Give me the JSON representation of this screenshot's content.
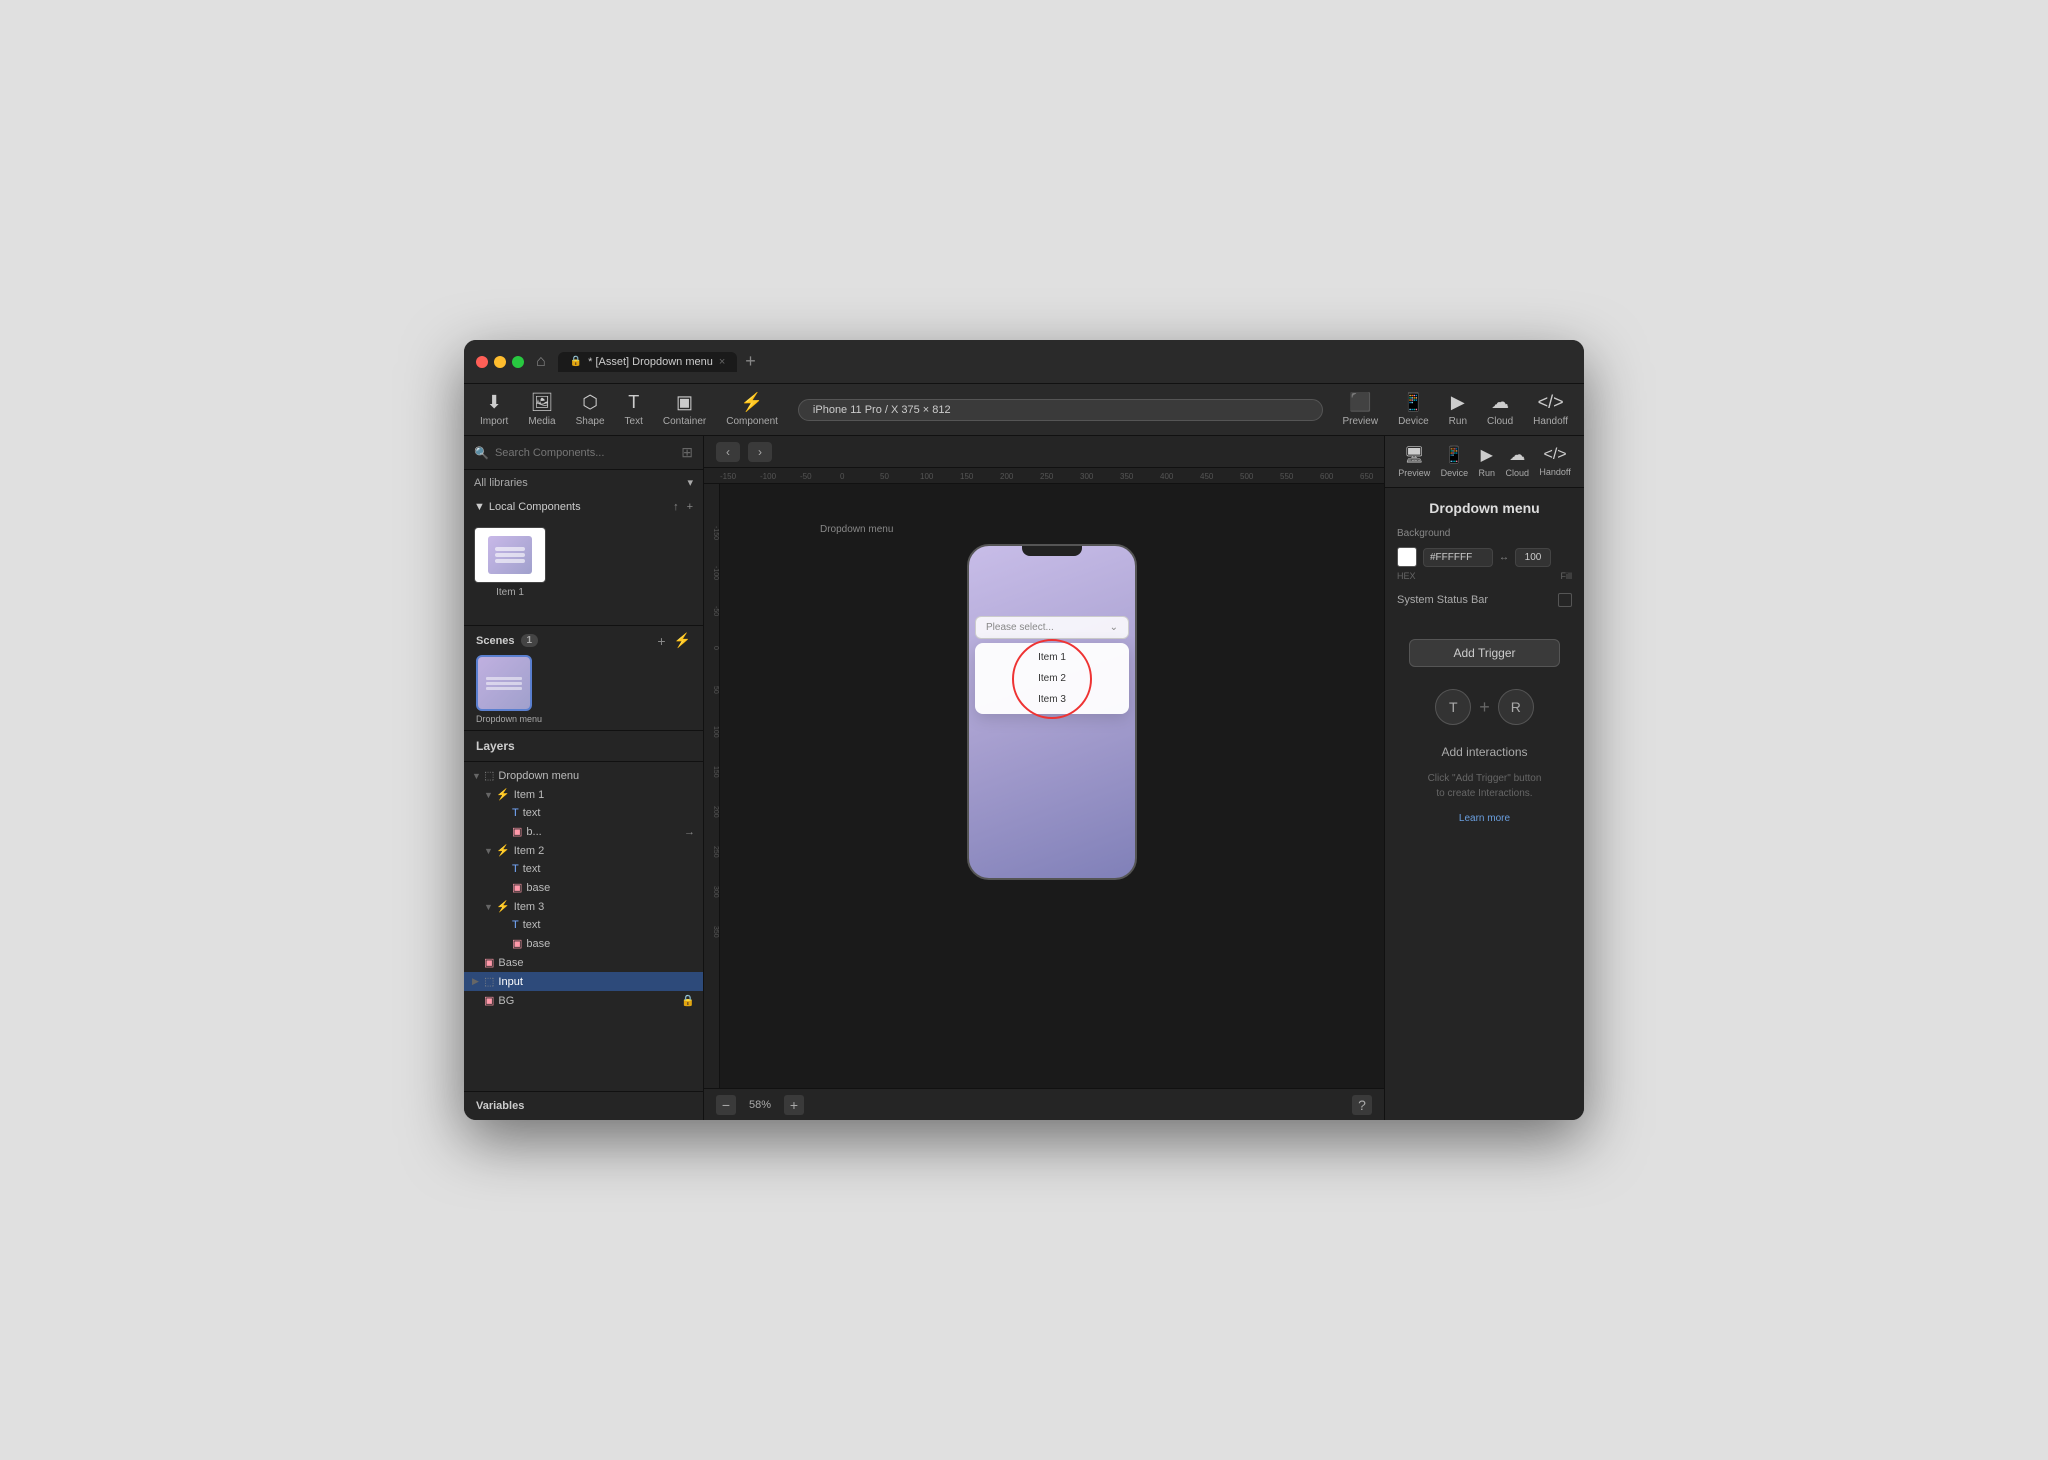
{
  "window": {
    "title": "Dropdown menu",
    "tab_label": "* [Asset] Dropdown menu",
    "tab_close": "×"
  },
  "toolbar": {
    "import_label": "Import",
    "media_label": "Media",
    "shape_label": "Shape",
    "text_label": "Text",
    "container_label": "Container",
    "component_label": "Component",
    "device_label": "iPhone 11 Pro / X  375 × 812",
    "preview_label": "Preview",
    "device_btn_label": "Device",
    "run_label": "Run",
    "cloud_label": "Cloud",
    "handoff_label": "Handoff"
  },
  "components_panel": {
    "search_placeholder": "Search Components...",
    "all_libraries_label": "All libraries",
    "local_components_label": "Local Components",
    "component_item_label": "Item 1"
  },
  "layers": {
    "header_label": "Layers",
    "scenes_label": "Scenes",
    "scenes_count": "1",
    "items": [
      {
        "indent": 0,
        "type": "frame",
        "name": "Dropdown menu",
        "expanded": true,
        "chevron": "▼"
      },
      {
        "indent": 1,
        "type": "component",
        "name": "Item 1",
        "expanded": true,
        "chevron": "▼"
      },
      {
        "indent": 2,
        "type": "text",
        "name": "text",
        "expanded": false,
        "chevron": ""
      },
      {
        "indent": 2,
        "type": "image",
        "name": "b...",
        "expanded": false,
        "chevron": ""
      },
      {
        "indent": 1,
        "type": "component",
        "name": "Item 2",
        "expanded": true,
        "chevron": "▼"
      },
      {
        "indent": 2,
        "type": "text",
        "name": "text",
        "expanded": false,
        "chevron": ""
      },
      {
        "indent": 2,
        "type": "image",
        "name": "base",
        "expanded": false,
        "chevron": ""
      },
      {
        "indent": 1,
        "type": "component",
        "name": "Item 3",
        "expanded": true,
        "chevron": "▼"
      },
      {
        "indent": 2,
        "type": "text",
        "name": "text",
        "expanded": false,
        "chevron": ""
      },
      {
        "indent": 2,
        "type": "image",
        "name": "base",
        "expanded": false,
        "chevron": ""
      },
      {
        "indent": 0,
        "type": "frame",
        "name": "Base",
        "expanded": false,
        "chevron": ""
      },
      {
        "indent": 0,
        "type": "frame",
        "name": "Input",
        "expanded": false,
        "chevron": "▶"
      },
      {
        "indent": 0,
        "type": "image",
        "name": "BG",
        "expanded": false,
        "chevron": "",
        "lock": true
      }
    ],
    "variables_label": "Variables"
  },
  "canvas": {
    "back_btn": "‹",
    "forward_btn": "›",
    "frame_label": "Dropdown menu",
    "dropdown_placeholder": "Please select...",
    "dropdown_arrow": "⌄",
    "dropdown_items": [
      "Item 1",
      "Item 2",
      "Item 3"
    ],
    "zoom_value": "58%",
    "zoom_in": "+",
    "zoom_out": "−",
    "help_btn": "?"
  },
  "right_panel": {
    "frame_title": "Dropdown menu",
    "background_label": "Background",
    "hex_value": "#FFFFFF",
    "hex_label": "HEX",
    "opacity_value": "100",
    "opacity_label": "Fill",
    "system_status_bar_label": "System Status Bar",
    "add_trigger_label": "Add Trigger",
    "interaction_t_icon": "T",
    "interaction_r_icon": "R",
    "add_interactions_title": "Add interactions",
    "add_interactions_desc": "Click \"Add Trigger\" button\nto create Interactions.",
    "learn_more_label": "Learn more"
  }
}
